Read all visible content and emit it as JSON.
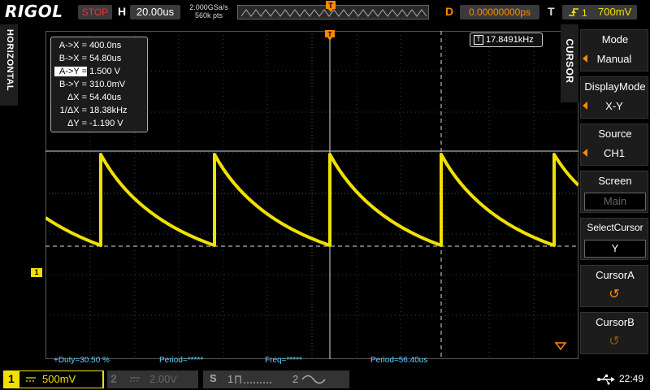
{
  "topbar": {
    "brand": "RIGOL",
    "run_status": "STOP",
    "h_label": "H",
    "timebase": "20.00us",
    "sample_rate": "2.000GSa/s",
    "memory_depth": "560k pts",
    "d_label": "D",
    "trigger_delay": "0.00000000ps",
    "t_label": "T",
    "trigger_level": "700mV"
  },
  "left_tab": {
    "label": "HORIZONTAL"
  },
  "cursor_tab": {
    "label": "CURSOR"
  },
  "menu": [
    {
      "title": "Mode",
      "value": "Manual"
    },
    {
      "title": "DisplayMode",
      "value": "X-Y"
    },
    {
      "title": "Source",
      "value": "CH1"
    },
    {
      "title": "Screen",
      "value": "Main"
    },
    {
      "title": "SelectCursor",
      "value": "Y"
    },
    {
      "title": "CursorA",
      "value": "↺"
    },
    {
      "title": "CursorB",
      "value": "↺"
    }
  ],
  "measurements": [
    {
      "key": "A->X =",
      "value": "400.0ns"
    },
    {
      "key": "B->X =",
      "value": "54.80us"
    },
    {
      "key": "A->Y =",
      "value": "1.500 V"
    },
    {
      "key": "B->Y =",
      "value": "310.0mV"
    },
    {
      "key": "ΔX =",
      "value": "54.40us"
    },
    {
      "key": "1/ΔX =",
      "value": "18.38kHz"
    },
    {
      "key": "ΔY =",
      "value": "-1.190 V"
    }
  ],
  "frequency_counter": "17.8491kHz",
  "ch1_marker": "1",
  "bottom_measurements": {
    "duty": "+Duty=30.50 %",
    "period1": "Period=*****",
    "freq": "Freq=*****",
    "period2": "Period=56.40us"
  },
  "channels": {
    "ch1_num": "1",
    "ch1_scale": "500mV",
    "ch2_num": "2",
    "ch2_scale": "2.00V",
    "s_label": "S",
    "s1_num": "1",
    "s2_num": "2"
  },
  "clock": "22:49",
  "colors": {
    "ch1": "#f0e000",
    "accent": "#ff8a00",
    "measure_text": "#5fd0ff"
  }
}
